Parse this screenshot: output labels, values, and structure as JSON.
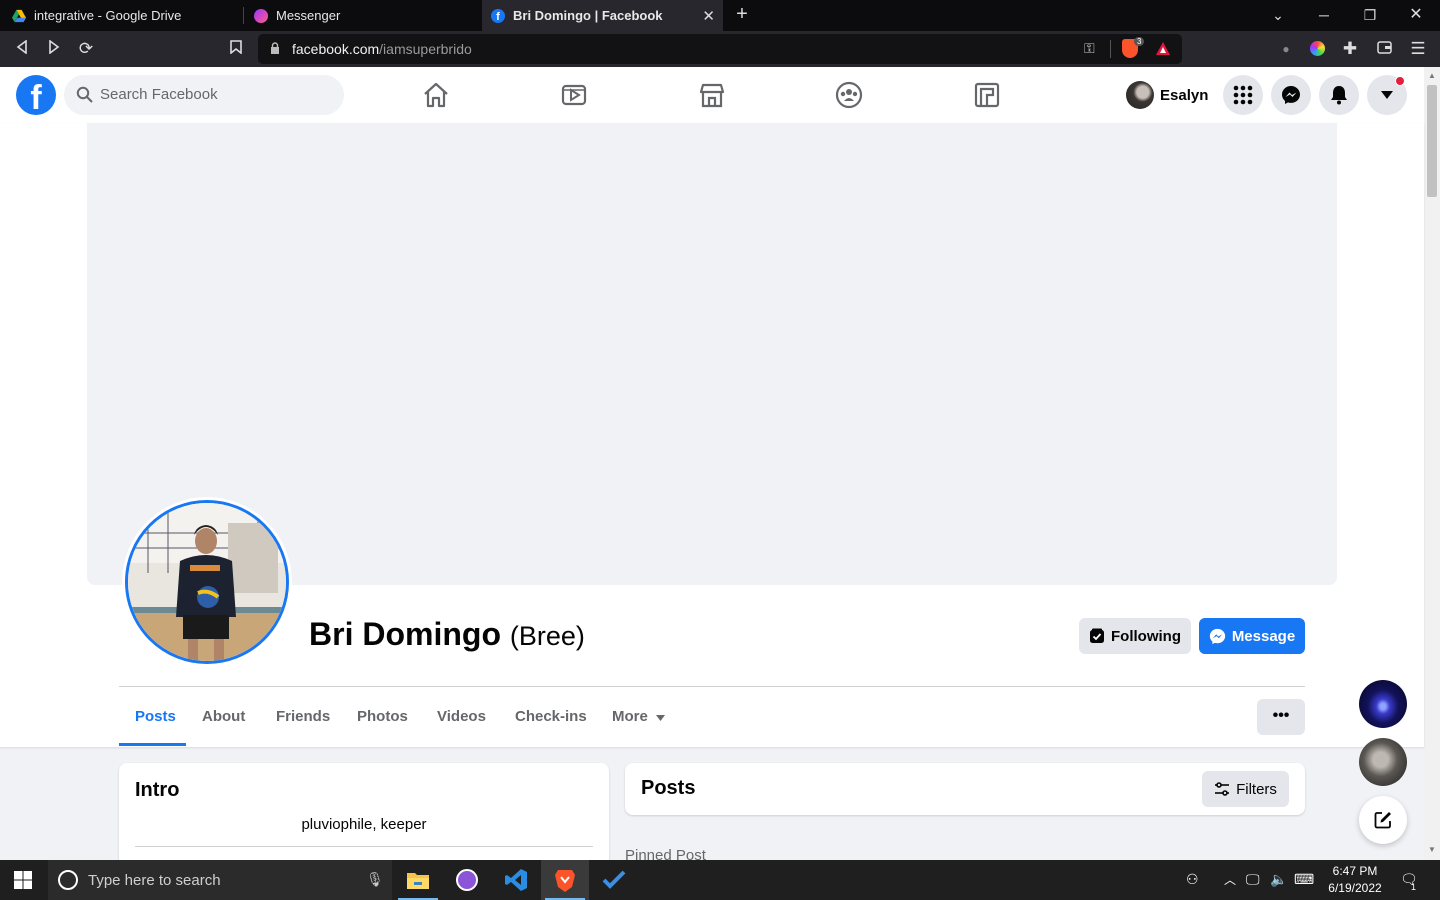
{
  "browser": {
    "tabs": [
      {
        "title": "integrative - Google Drive",
        "icon": "google-drive-icon",
        "active": false
      },
      {
        "title": "Messenger",
        "icon": "messenger-icon",
        "active": false
      },
      {
        "title": "Bri Domingo | Facebook",
        "icon": "facebook-icon",
        "active": true
      }
    ],
    "url": {
      "host": "facebook.com",
      "path": "/iamsuperbrido"
    },
    "brave_badge": "3"
  },
  "header": {
    "search_placeholder": "Search Facebook",
    "user_name": "Esalyn",
    "nav_icons": [
      "home-icon",
      "watch-icon",
      "marketplace-icon",
      "groups-icon",
      "gaming-icon"
    ],
    "has_notification_dot": true
  },
  "profile": {
    "name": "Bri Domingo",
    "nickname": "(Bree)",
    "following_label": "Following",
    "message_label": "Message",
    "tabs": [
      "Posts",
      "About",
      "Friends",
      "Photos",
      "Videos",
      "Check-ins",
      "More"
    ],
    "active_tab": "Posts",
    "more_options": "•••"
  },
  "intro": {
    "title": "Intro",
    "bio": "pluviophile, keeper"
  },
  "posts": {
    "title": "Posts",
    "filters_label": "Filters",
    "pinned_label": "Pinned Post"
  },
  "taskbar": {
    "search_placeholder": "Type here to search",
    "time": "6:47 PM",
    "date": "6/19/2022",
    "notification_count": "1"
  },
  "colors": {
    "fb_blue": "#1877f2",
    "page_bg": "#f0f2f5",
    "tab_bar": "#0c0c0e",
    "taskbar": "#1f1f1f"
  }
}
